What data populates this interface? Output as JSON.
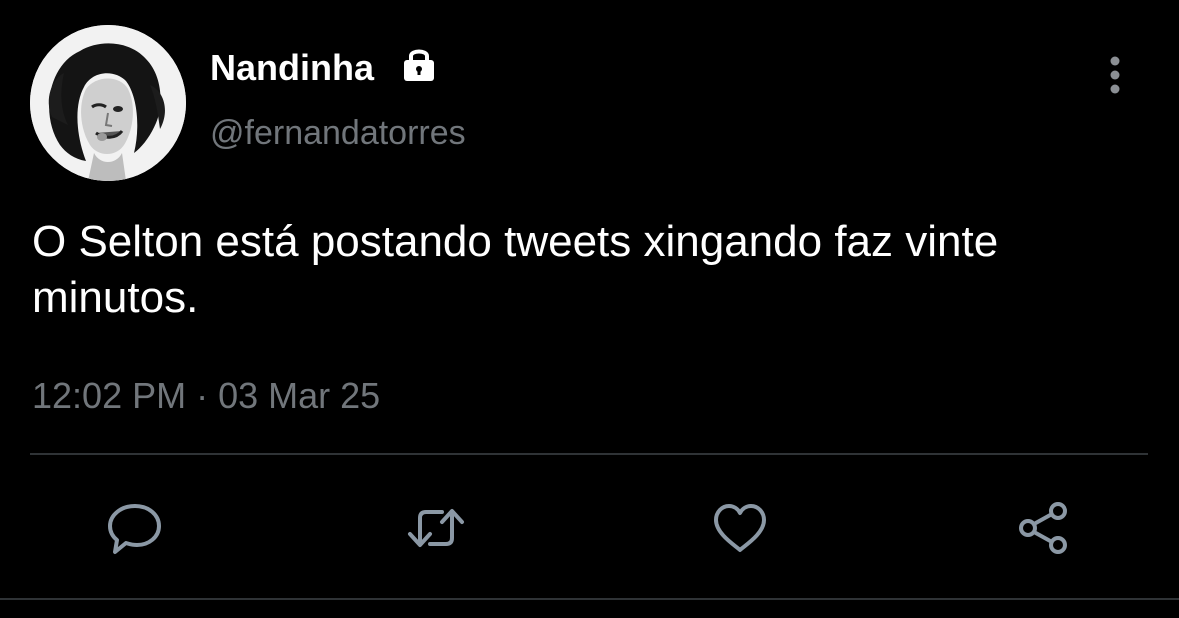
{
  "tweet": {
    "author": {
      "display_name": "Nandinha",
      "handle": "@fernandatorres",
      "protected": true
    },
    "text": "O Selton está postando tweets xingando faz vinte minutos.",
    "timestamp": "12:02 PM · 03 Mar 25"
  },
  "icons": {
    "lock": "lock-icon",
    "more": "more-vertical-icon",
    "reply": "reply-icon",
    "retweet": "retweet-icon",
    "like": "heart-icon",
    "share": "share-icon"
  },
  "colors": {
    "background": "#000000",
    "primary_text": "#ffffff",
    "secondary_text": "#71767b",
    "divider": "#2f3336"
  }
}
